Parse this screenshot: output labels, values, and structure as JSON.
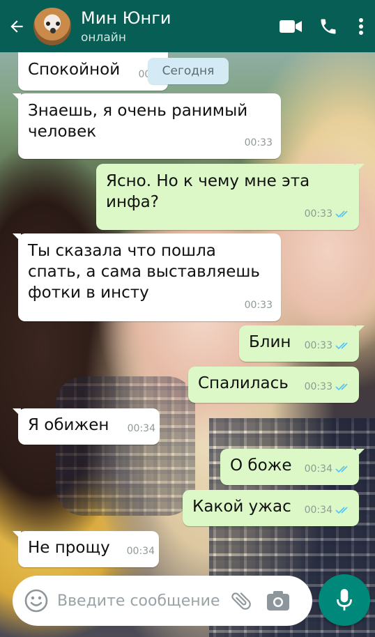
{
  "header": {
    "contact_name": "Мин Юнги",
    "status": "онлайн",
    "color": "#075e54"
  },
  "date_divider": "Сегодня",
  "messages": [
    {
      "direction": "in",
      "text": "Спокойной",
      "time": "00:"
    },
    {
      "direction": "in",
      "text": "Знаешь, я очень ранимый\nчеловек",
      "time": "00:33"
    },
    {
      "direction": "out",
      "text": "Ясно. Но к чему мне эта\nинфа?",
      "time": "00:33",
      "read": true
    },
    {
      "direction": "in",
      "text": "Ты сказала что пошла\nспать, а сама выставляешь\nфотки в инсту",
      "time": "00:33"
    },
    {
      "direction": "out",
      "text": "Блин",
      "time": "00:33",
      "read": true
    },
    {
      "direction": "out",
      "text": "Спалилась",
      "time": "00:33",
      "read": true
    },
    {
      "direction": "in",
      "text": "Я обижен",
      "time": "00:34"
    },
    {
      "direction": "out",
      "text": "О боже",
      "time": "00:34",
      "read": true
    },
    {
      "direction": "out",
      "text": "Какой ужас",
      "time": "00:34",
      "read": true
    },
    {
      "direction": "in",
      "text": "Не прощу",
      "time": "00:34"
    }
  ],
  "composer": {
    "placeholder": "Введите сообщение",
    "value": ""
  },
  "colors": {
    "incoming_bubble": "#ffffff",
    "outgoing_bubble": "#dcf8c6",
    "read_ticks": "#4fc3f7",
    "mic_button": "#00897b"
  },
  "icons": {
    "back": "arrow-left-icon",
    "video": "video-call-icon",
    "call": "phone-icon",
    "menu": "more-vert-icon",
    "emoji": "emoji-icon",
    "attach": "paperclip-icon",
    "camera": "camera-icon",
    "mic": "microphone-icon"
  }
}
